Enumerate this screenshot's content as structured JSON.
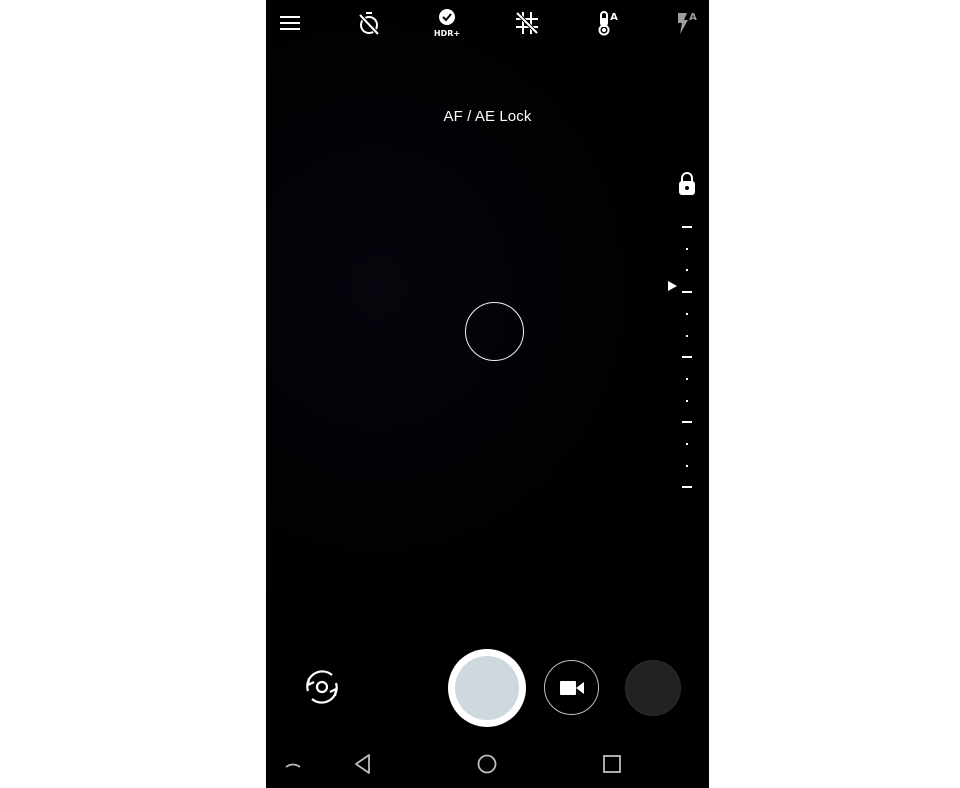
{
  "app": {
    "name": "Camera"
  },
  "topbar": {
    "icons": [
      {
        "name": "menu-icon",
        "label": "Menu"
      },
      {
        "name": "timer-off-icon",
        "label": "Timer off"
      },
      {
        "name": "hdr-plus-icon",
        "label": "HDR+",
        "badge_text": "HDR+"
      },
      {
        "name": "grid-off-icon",
        "label": "Grid off"
      },
      {
        "name": "white-balance-auto-icon",
        "label": "White balance auto",
        "badge_text": "A"
      },
      {
        "name": "flash-auto-icon",
        "label": "Flash auto",
        "badge_text": "A",
        "disabled": true
      }
    ]
  },
  "viewfinder": {
    "status_text": "AF / AE Lock",
    "exposure": {
      "locked": true,
      "major_ticks": 5,
      "minor_dots_between": 2,
      "current_position_fraction": 0.23
    }
  },
  "controls": {
    "switch_camera_label": "Switch camera",
    "shutter_label": "Take photo",
    "video_label": "Switch to video",
    "thumbnail_label": "Last photo"
  },
  "navbar": {
    "items": [
      {
        "name": "expand",
        "label": "Expand"
      },
      {
        "name": "back",
        "label": "Back"
      },
      {
        "name": "home",
        "label": "Home"
      },
      {
        "name": "recents",
        "label": "Recents"
      }
    ]
  },
  "colors": {
    "background": "#000000",
    "foreground": "#ffffff",
    "shutter_inner": "#cfd8dc",
    "disabled_icon": "#9e9e9e",
    "thumbnail": "#222222"
  }
}
